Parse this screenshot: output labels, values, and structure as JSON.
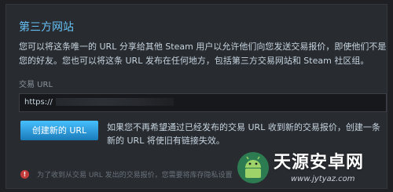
{
  "section": {
    "title": "第三方网站",
    "description_lines": [
      "您可以将这条唯一的 URL 分享给其他 Steam 用户以允许他们向您发送交易报价，即使他们不是",
      "您的好友。您也可以将这条 URL 发布在任何地方，包括第三方交易网站和 Steam 社区组。"
    ]
  },
  "trade_url": {
    "label": "交易 URL",
    "value_prefix": "https://"
  },
  "create_button": {
    "label": "创建新的 URL"
  },
  "create_note_lines": [
    "如果您不再希望通过已经发布的交易 URL 收到新的交易报价，创建一条",
    "新的 URL 将使旧有链接失效。"
  ],
  "warning": {
    "icon": "!",
    "text": "为了收到从交易 URL 发出的交易报价，您需要将库存隐私设置"
  },
  "watermark": {
    "brand": "天源安卓网",
    "url": "www.jytyaz.com"
  },
  "colors": {
    "background": "#1e2024",
    "panel": "#282b30",
    "accent_title": "#66c0f4",
    "button_top": "#47bfff",
    "button_bottom": "#1a7bb9",
    "warning_icon": "#c23b3b"
  }
}
